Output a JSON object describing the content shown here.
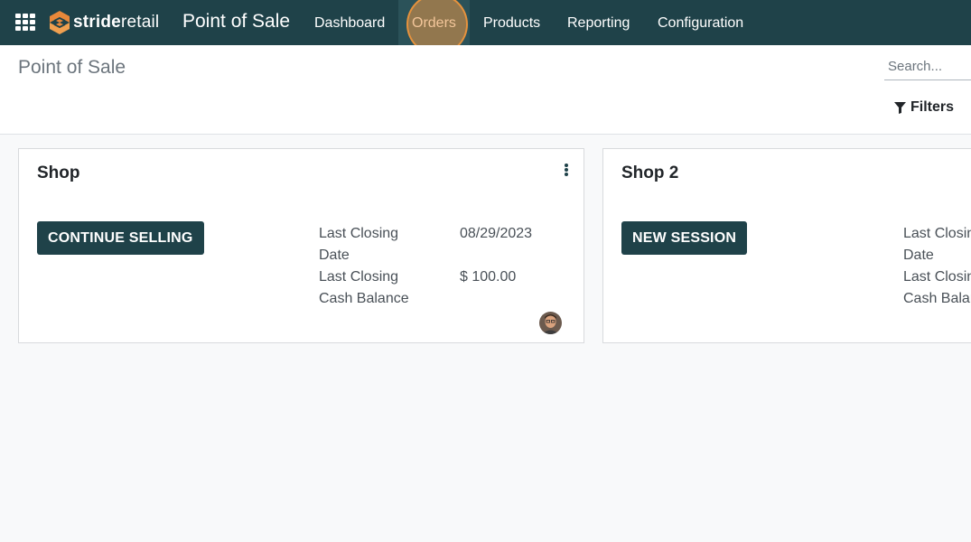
{
  "navbar": {
    "brand_part1": "stride",
    "brand_part2": "retail",
    "app_title": "Point of Sale",
    "menu": [
      {
        "label": "Dashboard"
      },
      {
        "label": "Orders"
      },
      {
        "label": "Products"
      },
      {
        "label": "Reporting"
      },
      {
        "label": "Configuration"
      }
    ],
    "active_item": "Orders",
    "colors": {
      "background": "#1f4249",
      "active": "#2b5259",
      "click_highlight": "#e89646"
    }
  },
  "control_panel": {
    "title": "Point of Sale",
    "search": {
      "placeholder": "Search...",
      "value": ""
    },
    "filters_label": "Filters"
  },
  "shops": [
    {
      "name": "Shop",
      "action_label": "Continue Selling",
      "stats": [
        {
          "label": "Last Closing Date",
          "value": "08/29/2023"
        },
        {
          "label": "Last Closing Cash Balance",
          "value": "$ 100.00"
        }
      ],
      "has_menu": true,
      "has_user_avatar": true
    },
    {
      "name": "Shop 2",
      "action_label": "New Session",
      "stats": [
        {
          "label": "Last Closing Date",
          "value": ""
        },
        {
          "label": "Last Closing Cash Balance",
          "value": ""
        }
      ],
      "has_menu": false,
      "has_user_avatar": false
    }
  ],
  "icons": [
    "apps-grid-icon",
    "brand-logo-icon",
    "filter-icon",
    "kebab-menu-icon",
    "user-avatar"
  ]
}
